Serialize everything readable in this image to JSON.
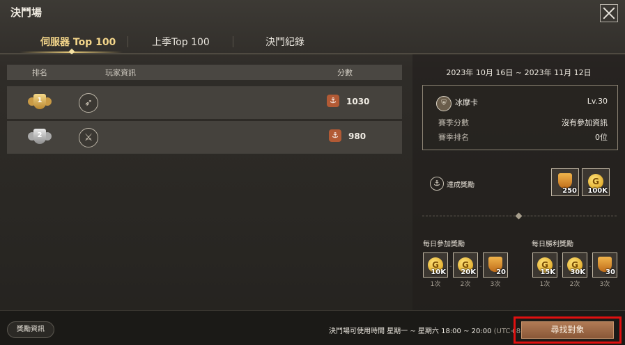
{
  "window": {
    "title": "決鬥場",
    "close_icon": "close-icon"
  },
  "tabs": [
    {
      "label": "伺服器 Top 100",
      "active": true
    },
    {
      "label": "上季Top 100",
      "active": false
    },
    {
      "label": "決鬥紀錄",
      "active": false
    }
  ],
  "leaderboard": {
    "headers": {
      "rank": "排名",
      "player": "玩家資訊",
      "score": "分數"
    },
    "rows": [
      {
        "rank": "1",
        "rank_badge": "gold-rank-badge",
        "class_icon": "bow-icon",
        "score": "1030"
      },
      {
        "rank": "2",
        "rank_badge": "silver-rank-badge",
        "class_icon": "sword-icon",
        "score": "980"
      }
    ]
  },
  "season": {
    "date_range": "2023年 10月 16日 ~ 2023年 11月 12日",
    "player_name": "冰摩卡",
    "level": "Lv.30",
    "season_score_label": "賽季分數",
    "season_score_value": "沒有參加資訊",
    "season_rank_label": "賽季排名",
    "season_rank_value": "0位"
  },
  "achievement_reward": {
    "label": "達成獎勵",
    "items": [
      {
        "icon": "crown-shield-icon",
        "qty": "250"
      },
      {
        "icon": "gold-coin-icon",
        "qty": "100K"
      }
    ]
  },
  "daily_participation": {
    "label": "每日參加獎勵",
    "items": [
      {
        "icon": "gold-coin-icon",
        "qty": "10K",
        "count": "1次"
      },
      {
        "icon": "gold-coin-icon",
        "qty": "20K",
        "count": "2次"
      },
      {
        "icon": "crown-shield-icon",
        "qty": "20",
        "count": "3次"
      }
    ]
  },
  "daily_victory": {
    "label": "每日勝利獎勵",
    "items": [
      {
        "icon": "gold-coin-icon",
        "qty": "15K",
        "count": "1次"
      },
      {
        "icon": "gold-coin-icon",
        "qty": "30K",
        "count": "2次"
      },
      {
        "icon": "crown-shield-icon",
        "qty": "30",
        "count": "3次"
      }
    ]
  },
  "bottom": {
    "reward_info_button": "獎勵資訊",
    "hours_text": "決鬥場可使用時間 星期一 ~ 星期六 18:00 ~ 20:00",
    "timezone": "(UTC+8)",
    "find_opponent_button": "尋找對象"
  },
  "colors": {
    "accent_gold": "#f3d58a",
    "button_brown": "#9a6644",
    "highlight_red": "#e01010"
  }
}
